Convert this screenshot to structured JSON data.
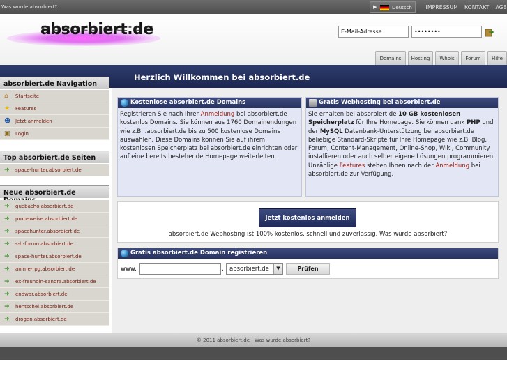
{
  "topbar": {
    "tagline": "Was wurde absorbiert?",
    "language": "Deutsch",
    "links": [
      "IMPRESSUM",
      "KONTAKT",
      "AGB"
    ]
  },
  "header": {
    "logo": "absorbiert.de",
    "email_placeholder": "E-Mail-Adresse",
    "password_value": "••••••••",
    "tabs": [
      "Domains",
      "Hosting",
      "Whois",
      "Forum",
      "Hilfe"
    ]
  },
  "banner": {
    "title": "Herzlich Willkommen bei absorbiert.de"
  },
  "sidebar": {
    "nav_title": "absorbiert.de Navigation",
    "nav_items": [
      {
        "label": "Startseite",
        "icon": "home-icon"
      },
      {
        "label": "Features",
        "icon": "star-icon"
      },
      {
        "label": "Jetzt anmelden",
        "icon": "user-add-icon"
      },
      {
        "label": "Login",
        "icon": "login-icon"
      }
    ],
    "top_title": "Top absorbiert.de Seiten",
    "top_items": [
      "space-hunter.absorbiert.de"
    ],
    "new_title": "Neue absorbiert.de Domains",
    "new_items": [
      "quebacho.absorbiert.de",
      "probeweise.absorbiert.de",
      "spacehunter.absorbiert.de",
      "s-h-forum.absorbiert.de",
      "space-hunter.absorbiert.de",
      "anime-rpg.absorbiert.de",
      "ex-freundin-sandra.absorbiert.de",
      "endwar.absorbiert.de",
      "hentschel.absorbiert.de",
      "drogen.absorbiert.de"
    ]
  },
  "domains_box": {
    "title": "Kostenlose absorbiert.de Domains",
    "t1": "Registrieren Sie nach Ihrer ",
    "link1": "Anmeldung",
    "t2": " bei absorbiert.de kostenlos Domains. Sie können aus 1760 Domainendungen wie z.B. .absorbiert.de bis zu 500 kostenlose Domains auswählen. Diese Domains können Sie auf ihrem kostenlosen Speicherplatz bei absorbiert.de einrichten oder auf eine bereits bestehende Homepage weiterleiten."
  },
  "hosting_box": {
    "title": "Gratis Webhosting bei absorbiert.de",
    "t1": "Sie erhalten bei absorbiert.de ",
    "b1": "10 GB kostenlosen Speicherplatz",
    "t2": " für Ihre Homepage. Sie können dank ",
    "b2": "PHP",
    "t3": " und der ",
    "b3": "MySQL",
    "t4": " Datenbank-Unterstützung bei absorbiert.de beliebige Standard-Skripte für Ihre Homepage wie z.B. Blog, Forum, Content-Management, Online-Shop, Wiki, Community installieren oder auch selber eigene Lösungen programmieren.",
    "t5": "Unzählige ",
    "link1": "Features",
    "t6": " stehen Ihnen nach der ",
    "link2": "Anmeldung",
    "t7": " bei absorbiert.de zur Verfügung."
  },
  "cta": {
    "button": "Jetzt kostenlos anmelden",
    "text": "absorbiert.de Webhosting ist 100% kostenlos, schnell und zuverlässig. Was wurde absorbiert?"
  },
  "register": {
    "title": "Gratis absorbiert.de Domain registrieren",
    "prefix": "www.",
    "dot": ".",
    "tld": "absorbiert.de",
    "button": "Prüfen"
  },
  "footer": {
    "text": "© 2011 absorbiert.de - Was wurde absorbiert?"
  }
}
